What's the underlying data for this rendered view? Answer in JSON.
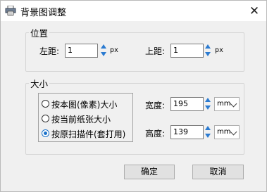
{
  "window": {
    "title": "背景图调整"
  },
  "position_group": {
    "title": "位置",
    "left": {
      "label": "左距:",
      "value": "1",
      "unit": "px"
    },
    "top": {
      "label": "上距:",
      "value": "1",
      "unit": "px"
    }
  },
  "size_group": {
    "title": "大小",
    "options": [
      {
        "label": "按本图(像素)大小",
        "selected": false
      },
      {
        "label": "按当前纸张大小",
        "selected": false
      },
      {
        "label": "按原扫描件(套打用)",
        "selected": true
      }
    ],
    "width": {
      "label": "宽度:",
      "value": "195",
      "unit": "mm"
    },
    "height": {
      "label": "高度:",
      "value": "139",
      "unit": "mm"
    }
  },
  "buttons": {
    "ok": "确定",
    "cancel": "取消"
  },
  "colors": {
    "accent": "#1c72c9",
    "spin": "#2b7bd1"
  }
}
